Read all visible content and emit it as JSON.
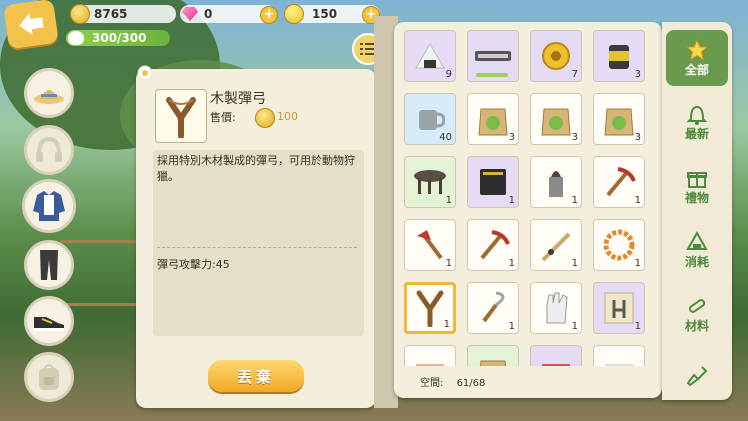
{
  "currency": {
    "coins": "8765",
    "gems": "0",
    "tickets": "150",
    "energy": "300/300"
  },
  "detail": {
    "name": "木製彈弓",
    "price_label": "售價:",
    "price": "100",
    "description": "採用特別木材製成的彈弓，可用於動物狩獵。",
    "stat": "彈弓攻擊力:45",
    "discard_label": "丟棄"
  },
  "left_categories": [
    "hat-icon",
    "headphones-icon",
    "jacket-icon",
    "pants-icon",
    "shoes-icon",
    "backpack-icon"
  ],
  "inventory": {
    "space_label": "空間:",
    "space_value": "61/68",
    "slots": [
      {
        "icon": "rice-ball-icon",
        "count": "9",
        "bg": "#e6dbf5"
      },
      {
        "icon": "harmonica-icon",
        "count": "",
        "bg": "#e6dbf5",
        "bar": true
      },
      {
        "icon": "gold-badge-icon",
        "count": "7",
        "bg": "#e6dbf5"
      },
      {
        "icon": "tin-can-icon",
        "count": "3",
        "bg": "#e6dbf5"
      },
      {
        "icon": "mug-icon",
        "count": "40",
        "bg": "#d7ecfb"
      },
      {
        "icon": "seed-bag-icon",
        "count": "3",
        "bg": "#fffdf5"
      },
      {
        "icon": "seed-bag-icon",
        "count": "3",
        "bg": "#fffdf5"
      },
      {
        "icon": "seed-bag-icon",
        "count": "3",
        "bg": "#fffdf5"
      },
      {
        "icon": "round-table-icon",
        "count": "1",
        "bg": "#e3f3d4"
      },
      {
        "icon": "amplifier-icon",
        "count": "1",
        "bg": "#e6dbf5"
      },
      {
        "icon": "torch-icon",
        "count": "1",
        "bg": "#fffdf5"
      },
      {
        "icon": "pickaxe-icon",
        "count": "1",
        "bg": "#fffdf5"
      },
      {
        "icon": "axe-icon",
        "count": "1",
        "bg": "#fffdf5"
      },
      {
        "icon": "pickaxe-icon",
        "count": "1",
        "bg": "#fffdf5"
      },
      {
        "icon": "fishing-rod-icon",
        "count": "1",
        "bg": "#fffdf5"
      },
      {
        "icon": "rope-icon",
        "count": "1",
        "bg": "#fffdf5"
      },
      {
        "icon": "slingshot-icon",
        "count": "1",
        "bg": "#fffdf5",
        "selected": true
      },
      {
        "icon": "sickle-icon",
        "count": "1",
        "bg": "#fffdf5"
      },
      {
        "icon": "glove-icon",
        "count": "1",
        "bg": "#fffdf5"
      },
      {
        "icon": "chair-blueprint-icon",
        "count": "1",
        "bg": "#e6dbf5"
      },
      {
        "icon": "scroll-icon",
        "count": "",
        "bg": "#fffdf5"
      },
      {
        "icon": "seed-bag-icon",
        "count": "",
        "bg": "#e3f3d4"
      },
      {
        "icon": "gift-box-icon",
        "count": "",
        "bg": "#e6dbf5"
      },
      {
        "icon": "paper-stack-icon",
        "count": "",
        "bg": "#fffdf5"
      }
    ]
  },
  "tabs": [
    {
      "label": "全部",
      "icon": "star-icon",
      "active": true
    },
    {
      "label": "最新",
      "icon": "bell-icon"
    },
    {
      "label": "禮物",
      "icon": "gift-icon"
    },
    {
      "label": "消耗",
      "icon": "rice-ball-icon"
    },
    {
      "label": "材料",
      "icon": "wood-icon"
    },
    {
      "label": "",
      "icon": "shovel-icon"
    }
  ],
  "colors": {
    "accent": "#f0b73b",
    "tab_active": "#6a9a4e",
    "tab_text": "#4d8a3c"
  }
}
